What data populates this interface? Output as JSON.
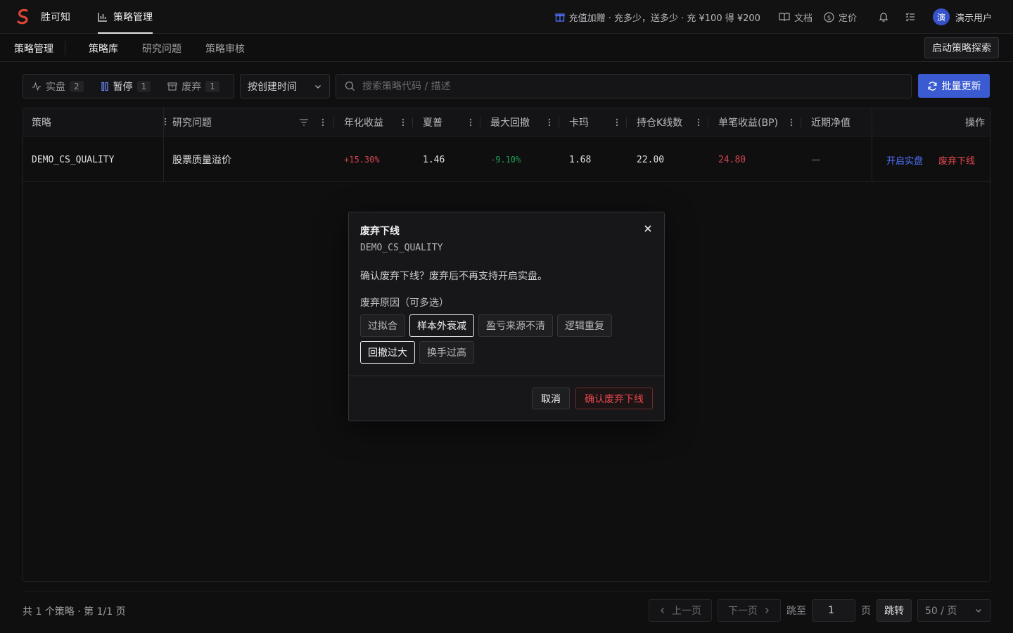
{
  "topbar": {
    "brand_name": "胜可知",
    "nav_item": "策略管理",
    "promo": "充值加赠 · 充多少，送多少 · 充 ¥100 得 ¥200",
    "docs": "文档",
    "pricing": "定价",
    "avatar_initial": "演",
    "user_name": "演示用户"
  },
  "subbar": {
    "title": "策略管理",
    "tabs": [
      "策略库",
      "研究问题",
      "策略审核"
    ],
    "explore_button": "启动策略探索"
  },
  "filters": {
    "segments": [
      {
        "label": "实盘",
        "count": "2"
      },
      {
        "label": "暂停",
        "count": "1"
      },
      {
        "label": "废弃",
        "count": "1"
      }
    ],
    "sort": "按创建时间",
    "search_placeholder": "搜索策略代码 / 描述",
    "batch_button": "批量更新"
  },
  "table": {
    "headers": [
      "策略",
      "研究问题",
      "年化收益",
      "夏普",
      "最大回撤",
      "卡玛",
      "持仓K线数",
      "单笔收益(BP)",
      "近期净值",
      "操作"
    ],
    "rows": [
      {
        "strategy": "DEMO_CS_QUALITY",
        "question": "股票质量溢价",
        "annual_return": "+15.30%",
        "sharpe": "1.46",
        "max_drawdown": "-9.10%",
        "calmar": "1.68",
        "holding_bars": "22.00",
        "per_trade_bp": "24.80",
        "recent_nav": "—",
        "action_live": "开启实盘",
        "action_retire": "废弃下线"
      }
    ]
  },
  "footer": {
    "total": "共 1 个策略 · 第 1/1 页",
    "prev": "上一页",
    "next": "下一页",
    "jump_label": "跳至",
    "jump_value": "1",
    "page_unit": "页",
    "jump_button": "跳转",
    "page_size": "50 / 页"
  },
  "modal": {
    "title": "废弃下线",
    "subtitle": "DEMO_CS_QUALITY",
    "message": "确认废弃下线？废弃后不再支持开启实盘。",
    "reason_label": "废弃原因（可多选）",
    "reasons": [
      "过拟合",
      "样本外衰减",
      "盈亏来源不清",
      "逻辑重复",
      "回撤过大",
      "换手过高"
    ],
    "cancel": "取消",
    "confirm": "确认废弃下线"
  }
}
